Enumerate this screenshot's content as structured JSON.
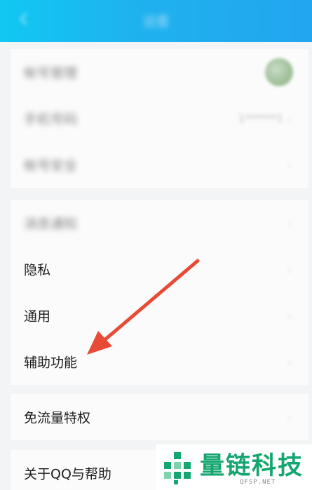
{
  "header": {
    "title": "设置"
  },
  "groups": [
    {
      "rows": [
        {
          "label": "帐号管理",
          "blurred": true
        },
        {
          "label": "手机号码",
          "blurred": true,
          "value": "1******1"
        },
        {
          "label": "帐号安全",
          "blurred": true
        }
      ]
    },
    {
      "rows": [
        {
          "label": "消息通知",
          "blurred": true
        },
        {
          "label": "隐私"
        },
        {
          "label": "通用"
        },
        {
          "label": "辅助功能"
        }
      ]
    },
    {
      "rows": [
        {
          "label": "免流量特权"
        }
      ]
    },
    {
      "rows": [
        {
          "label": "关于QQ与帮助"
        }
      ]
    }
  ],
  "annotation": {
    "arrow_color": "#e74b35"
  },
  "watermark": {
    "text": "量链科技",
    "subtext": "QFSP.NET",
    "color": "#14a66f"
  }
}
